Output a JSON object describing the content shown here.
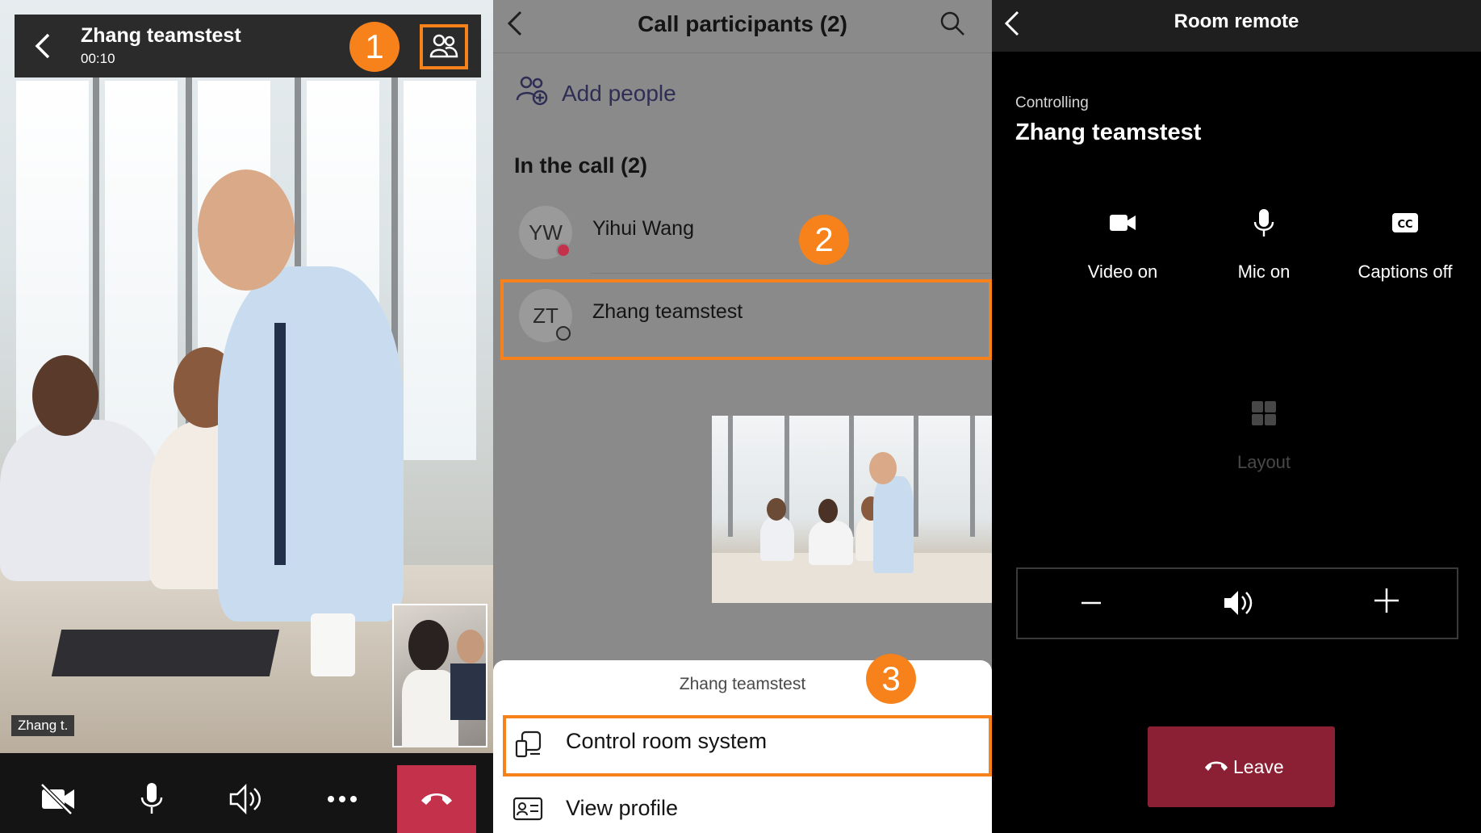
{
  "panel1": {
    "contact_name": "Zhang teamstest",
    "call_timer": "00:10",
    "step_number": "1",
    "name_tag": "Zhang t."
  },
  "panel2": {
    "title": "Call participants (2)",
    "add_people_label": "Add people",
    "section_title": "In the call (2)",
    "participants": [
      {
        "initials": "YW",
        "name": "Yihui Wang",
        "status_color": "#c4314b"
      },
      {
        "initials": "ZT",
        "name": "Zhang teamstest",
        "status_color": "#8a8a8a"
      }
    ],
    "step2_number": "2",
    "step3_number": "3",
    "sheet": {
      "title": "Zhang teamstest",
      "items": [
        {
          "label": "Control room system"
        },
        {
          "label": "View profile"
        }
      ]
    }
  },
  "panel3": {
    "title": "Room remote",
    "controlling_label": "Controlling",
    "controlled_name": "Zhang teamstest",
    "buttons": [
      {
        "label": "Video on"
      },
      {
        "label": "Mic on"
      },
      {
        "label": "Captions off"
      },
      {
        "label": "Layout"
      }
    ],
    "leave_label": "Leave"
  },
  "colors": {
    "highlight": "#f7821b",
    "end_call": "#c4314b",
    "leave": "#8b1f33"
  }
}
